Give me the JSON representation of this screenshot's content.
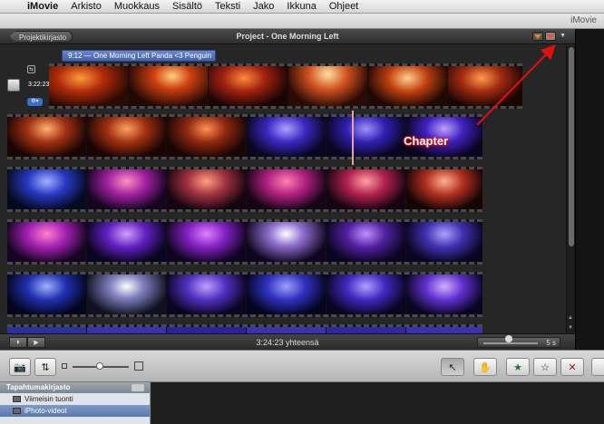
{
  "menubar": {
    "apple": "",
    "items": [
      "iMovie",
      "Arkisto",
      "Muokkaus",
      "Sisältö",
      "Teksti",
      "Jako",
      "Ikkuna",
      "Ohjeet"
    ]
  },
  "window": {
    "title": "iMovie"
  },
  "project_bar": {
    "back_label": "Projektikirjasto",
    "title": "Project - One Morning Left"
  },
  "timeline": {
    "title_banner": "9:12 — One Morning Left Panda <3 Penguin",
    "duration": "3:22:23",
    "chapter_annotation": "Chapter"
  },
  "footer": {
    "total": "3:24:23 yhteensä",
    "zoom_value": "5 s"
  },
  "events_library": {
    "header": "Tapahtumakirjasto",
    "items": [
      {
        "label": "Viimeisin tuonti"
      },
      {
        "label": "iPhoto-videot"
      }
    ]
  },
  "colors": {
    "title_banner": "#5873b8",
    "annotation": "#e01010",
    "selection": "#6a86bb"
  }
}
